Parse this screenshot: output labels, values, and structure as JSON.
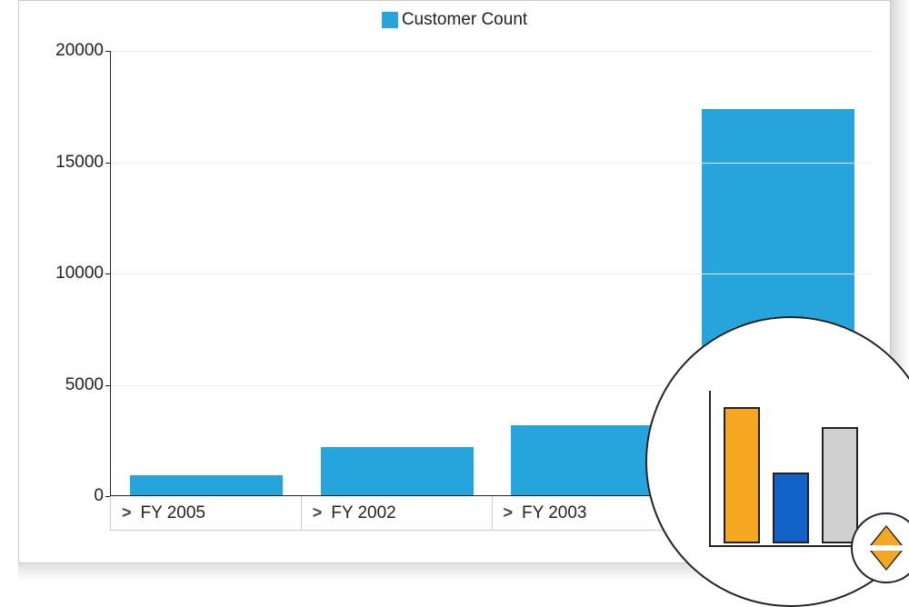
{
  "legend": {
    "label": "Customer Count",
    "swatch_color": "#26a5dc"
  },
  "chart_data": {
    "type": "bar",
    "categories": [
      "FY 2005",
      "FY 2002",
      "FY 2003",
      ""
    ],
    "values": [
      950,
      2200,
      3200,
      17400
    ],
    "series_name": "Customer Count",
    "ylabel": "",
    "xlabel": "",
    "ylim": [
      0,
      20000
    ],
    "yticks": [
      0,
      5000,
      10000,
      15000,
      20000
    ]
  },
  "axis_buttons": [
    {
      "chevron": ">",
      "label": "FY 2005"
    },
    {
      "chevron": ">",
      "label": "FY 2002"
    },
    {
      "chevron": ">",
      "label": "FY 2003"
    },
    {
      "chevron": "",
      "label": ""
    }
  ],
  "bubble_icon": {
    "bars": [
      "orange",
      "blue",
      "grey"
    ],
    "sort": "up-down"
  }
}
